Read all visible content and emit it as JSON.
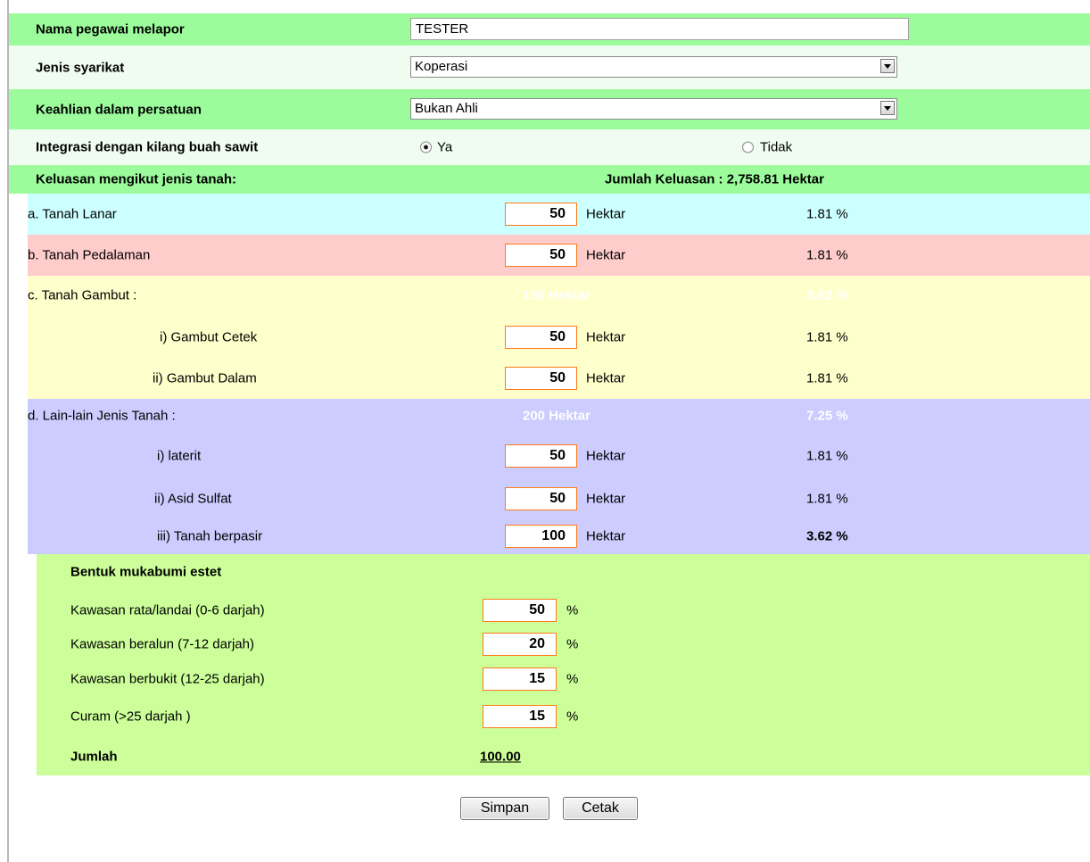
{
  "form": {
    "nama_pegawai": {
      "label": "Nama pegawai melapor",
      "value": "TESTER"
    },
    "jenis_syarikat": {
      "label": "Jenis syarikat",
      "value": "Koperasi"
    },
    "keahlian": {
      "label": "Keahlian dalam persatuan",
      "value": "Bukan Ahli"
    },
    "integrasi": {
      "label": "Integrasi dengan kilang buah sawit",
      "option_ya": "Ya",
      "option_tidak": "Tidak",
      "selected": "Ya"
    }
  },
  "keluasan": {
    "label": "Keluasan mengikut jenis tanah:",
    "jumlah": "Jumlah Keluasan : 2,758.81 Hektar",
    "unit": "Hektar",
    "lanar": {
      "label": "a. Tanah Lanar",
      "value": "50",
      "pct": "1.81 %"
    },
    "pedalaman": {
      "label": "b. Tanah Pedalaman",
      "value": "50",
      "pct": "1.81 %"
    },
    "gambut": {
      "label": "c. Tanah Gambut :",
      "total": "100 Hektar",
      "total_pct": "3.62 %",
      "cetek": {
        "label": "i) Gambut Cetek",
        "value": "50",
        "pct": "1.81 %"
      },
      "dalam": {
        "label": "ii) Gambut Dalam",
        "value": "50",
        "pct": "1.81 %"
      }
    },
    "lain": {
      "label": "d. Lain-lain Jenis Tanah :",
      "total": "200 Hektar",
      "total_pct": "7.25 %",
      "laterit": {
        "label": "i) laterit",
        "value": "50",
        "pct": "1.81 %"
      },
      "asid": {
        "label": "ii) Asid Sulfat",
        "value": "50",
        "pct": "1.81 %"
      },
      "berpasir": {
        "label": "iii) Tanah berpasir",
        "value": "100",
        "pct": "3.62 %"
      }
    }
  },
  "mukabumi": {
    "title": "Bentuk mukabumi estet",
    "unit": "%",
    "rata": {
      "label": "Kawasan rata/landai (0-6 darjah)",
      "value": "50"
    },
    "beralun": {
      "label": "Kawasan beralun (7-12 darjah)",
      "value": "20"
    },
    "berbukit": {
      "label": "Kawasan berbukit (12-25 darjah)",
      "value": "15"
    },
    "curam": {
      "label": "Curam (>25 darjah )",
      "value": "15"
    },
    "jumlah_label": "Jumlah",
    "jumlah_value": "100.00"
  },
  "buttons": {
    "simpan": "Simpan",
    "cetak": "Cetak"
  },
  "colors": {
    "header_green": "#9cfc9c",
    "light_green": "#f1fcf1",
    "lanar": "#ccffff",
    "pedalaman": "#ffcccc",
    "gambut": "#ffffcc",
    "lain": "#ccccff",
    "mukabumi": "#ccff99",
    "input_border": "#ff7a1a"
  }
}
